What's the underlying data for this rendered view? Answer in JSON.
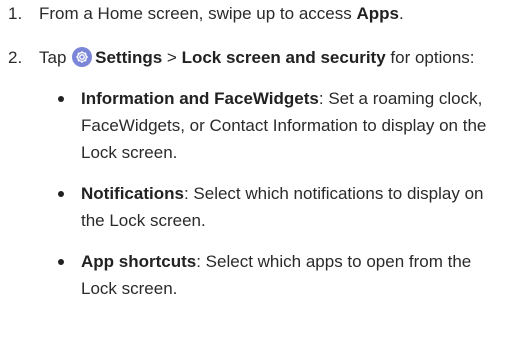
{
  "steps": [
    {
      "number": "1.",
      "text_before": "From a Home screen, swipe up to access ",
      "bold": "Apps",
      "text_after": "."
    },
    {
      "number": "2.",
      "text_before": "Tap ",
      "icon": "settings-gear-icon",
      "bold_settings": "Settings",
      "separator": " > ",
      "bold_path": "Lock screen and security",
      "text_after": " for options:"
    }
  ],
  "options": [
    {
      "title": "Information and FaceWidgets",
      "description": ": Set a roaming clock, FaceWidgets, or Contact Information to display on the Lock screen."
    },
    {
      "title": "Notifications",
      "description": ": Select which notifications to display on the Lock screen."
    },
    {
      "title": "App shortcuts",
      "description": ": Select which apps to open from the Lock screen."
    }
  ],
  "colors": {
    "text": "#2a2a2a",
    "icon_background": "#7b86d9"
  }
}
